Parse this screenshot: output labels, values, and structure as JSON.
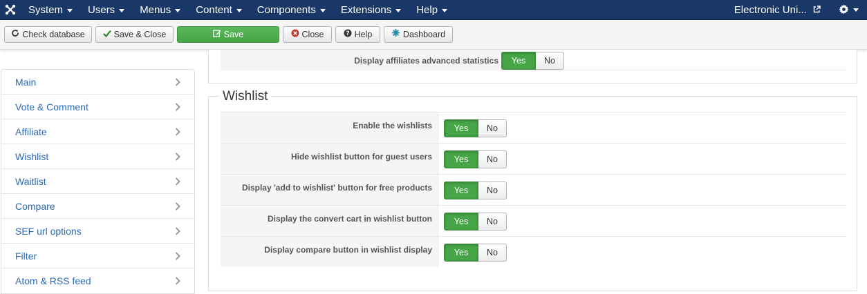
{
  "nav": {
    "menu": [
      {
        "label": "System"
      },
      {
        "label": "Users"
      },
      {
        "label": "Menus"
      },
      {
        "label": "Content"
      },
      {
        "label": "Components"
      },
      {
        "label": "Extensions"
      },
      {
        "label": "Help"
      }
    ],
    "site_name": "Electronic Uni...",
    "logo_icon": "joomla-logo-icon",
    "user_menu_icon": "gear-icon"
  },
  "toolbar": {
    "check_database": "Check database",
    "save_close": "Save & Close",
    "save": "Save",
    "close": "Close",
    "help": "Help",
    "dashboard": "Dashboard"
  },
  "sidebar": {
    "items": [
      {
        "label": "Main"
      },
      {
        "label": "Vote & Comment"
      },
      {
        "label": "Affiliate"
      },
      {
        "label": "Wishlist"
      },
      {
        "label": "Waitlist"
      },
      {
        "label": "Compare"
      },
      {
        "label": "SEF url options"
      },
      {
        "label": "Filter"
      },
      {
        "label": "Atom & RSS feed"
      }
    ]
  },
  "affiliate_section": {
    "rows": [
      {
        "label": "Display affiliates advanced statistics",
        "value": "Yes"
      }
    ]
  },
  "wishlist": {
    "legend": "Wishlist",
    "rows": [
      {
        "label": "Enable the wishlists",
        "value": "Yes"
      },
      {
        "label": "Hide wishlist button for guest users",
        "value": "Yes"
      },
      {
        "label": "Display 'add to wishlist' button for free products",
        "value": "Yes"
      },
      {
        "label": "Display the convert cart in wishlist button",
        "value": "Yes"
      },
      {
        "label": "Display compare button in wishlist display",
        "value": "Yes"
      }
    ]
  },
  "toggle": {
    "yes": "Yes",
    "no": "No"
  },
  "colors": {
    "navbar": "#1a3867",
    "accent_green": "#46a546",
    "link_blue": "#2a69b8"
  }
}
